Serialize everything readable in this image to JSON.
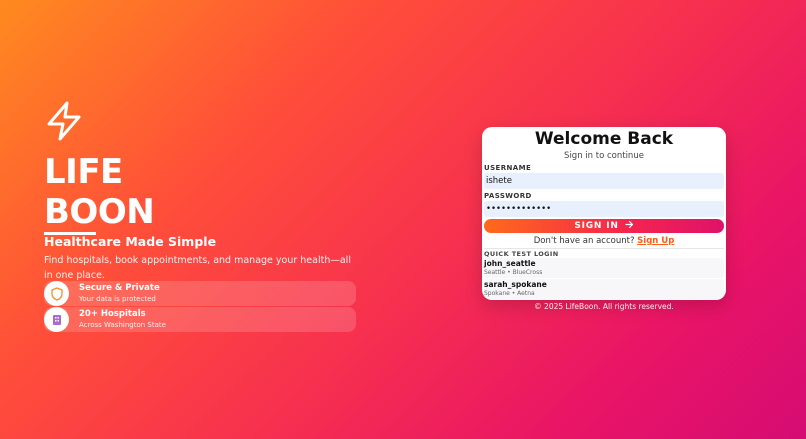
{
  "brand": {
    "line1": "LIFE",
    "line2": "BOON",
    "tagline": "Healthcare Made Simple",
    "description": "Find hospitals, book appointments, and manage your health—all in one place."
  },
  "features": [
    {
      "title": "Secure & Private",
      "subtitle": "Your data is protected",
      "icon": "shield-icon"
    },
    {
      "title": "20+ Hospitals",
      "subtitle": "Across Washington State",
      "icon": "hospital-icon"
    }
  ],
  "login": {
    "title": "Welcome Back",
    "subtitle": "Sign in to continue",
    "username_label": "USERNAME",
    "username_value": "ishete",
    "password_label": "PASSWORD",
    "password_value": "•••••••••••••",
    "signin_label": "SIGN IN",
    "no_account_text": "Don't have an account?",
    "signup_link": "Sign Up",
    "quick_login_heading": "QUICK TEST LOGIN",
    "quick_logins": [
      {
        "username": "john_seattle",
        "details": "Seattle • BlueCross"
      },
      {
        "username": "sarah_spokane",
        "details": "Spokane • Aetna"
      }
    ]
  },
  "footer": "© 2025 LifeBoon. All rights reserved.",
  "colors": {
    "gradient_start": "#ff8a1f",
    "gradient_end": "#d60c73",
    "accent": "#ff5a14"
  }
}
